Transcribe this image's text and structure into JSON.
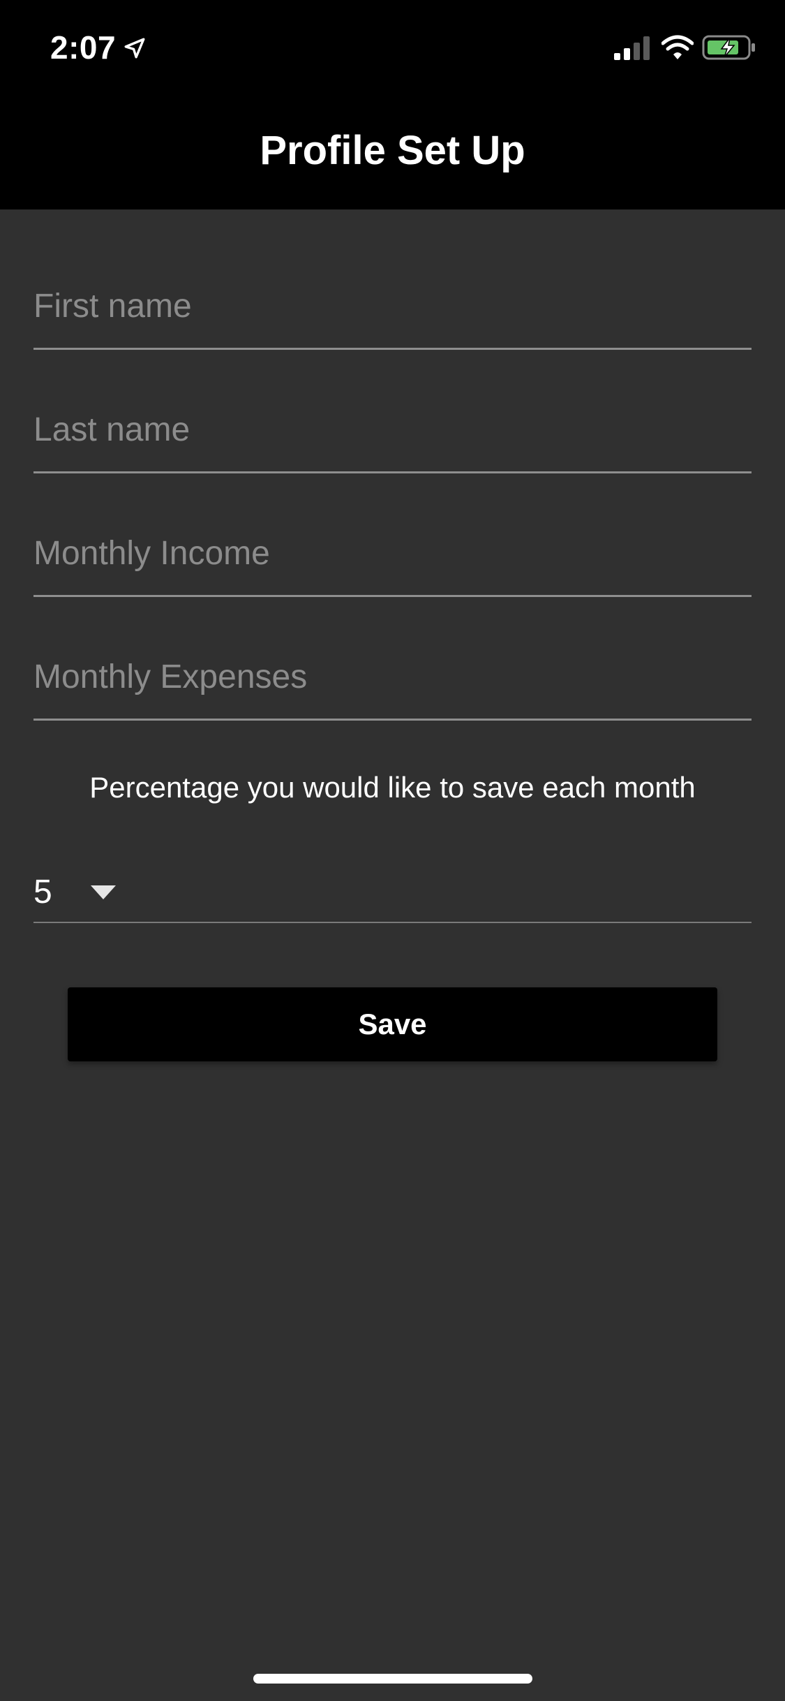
{
  "status_bar": {
    "time": "2:07"
  },
  "header": {
    "title": "Profile Set Up"
  },
  "form": {
    "first_name": {
      "value": "",
      "placeholder": "First name"
    },
    "last_name": {
      "value": "",
      "placeholder": "Last name"
    },
    "monthly_income": {
      "value": "",
      "placeholder": "Monthly Income"
    },
    "monthly_expenses": {
      "value": "",
      "placeholder": "Monthly Expenses"
    },
    "savings_label": "Percentage you would like to save each month",
    "savings_percentage": {
      "selected": "5"
    },
    "save_label": "Save"
  },
  "icons": {
    "location": "location-arrow-icon",
    "signal": "cellular-signal-icon",
    "wifi": "wifi-icon",
    "battery": "battery-charging-icon",
    "dropdown": "caret-down-icon"
  },
  "colors": {
    "background": "#303030",
    "header_background": "#000000",
    "button_background": "#000000",
    "placeholder_text": "#8c8c8c",
    "battery_charge": "#65c466"
  }
}
